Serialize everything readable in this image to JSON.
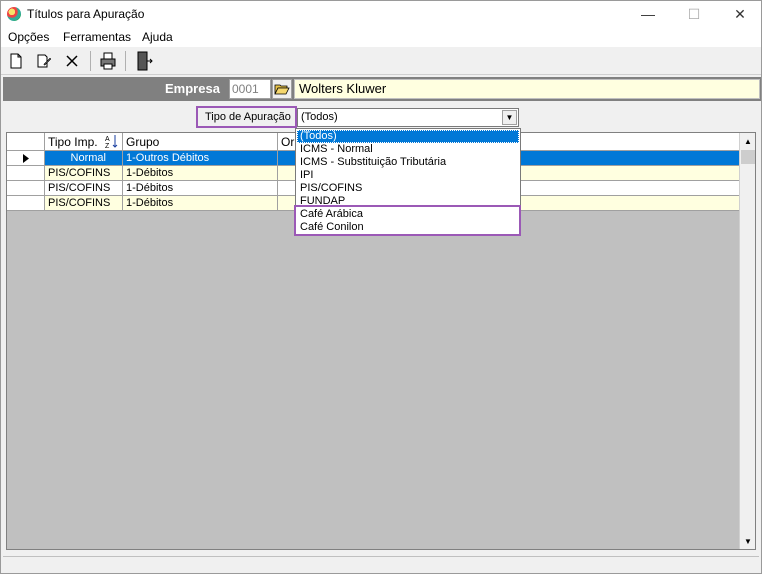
{
  "window": {
    "title": "Títulos para Apuração",
    "minimize_glyph": "—",
    "maximize_glyph": "☐",
    "close_glyph": "✕"
  },
  "menu": {
    "items": [
      "Opções",
      "Ferramentas",
      "Ajuda"
    ]
  },
  "toolbar": {
    "icons": [
      "new-document-icon",
      "edit-document-icon",
      "delete-icon",
      "print-icon",
      "exit-door-icon"
    ]
  },
  "empresa": {
    "label": "Empresa",
    "code": "0001",
    "name": "Wolters Kluwer"
  },
  "tipo_apuracao": {
    "label": "Tipo de Apuração",
    "selected": "(Todos)",
    "options": [
      "(Todos)",
      "ICMS - Normal",
      "ICMS - Substituição Tributária",
      "IPI",
      "PIS/COFINS",
      "FUNDAP",
      "Café Arábica",
      "Café Conilon"
    ]
  },
  "grid": {
    "columns": [
      "Tipo Imp.",
      "Grupo",
      "Or"
    ],
    "rows": [
      {
        "tipo": "Normal",
        "grupo": "1-Outros Débitos",
        "or": "",
        "selected": true
      },
      {
        "tipo": "PIS/COFINS",
        "grupo": "1-Débitos",
        "or": "",
        "selected": false
      },
      {
        "tipo": "PIS/COFINS",
        "grupo": "1-Débitos",
        "or": "",
        "selected": false
      },
      {
        "tipo": "PIS/COFINS",
        "grupo": "1-Débitos",
        "or": "",
        "selected": false
      }
    ]
  },
  "colors": {
    "highlight": "#9b59b6",
    "selection": "#0078d7",
    "row_bg": "#ffffe0"
  }
}
